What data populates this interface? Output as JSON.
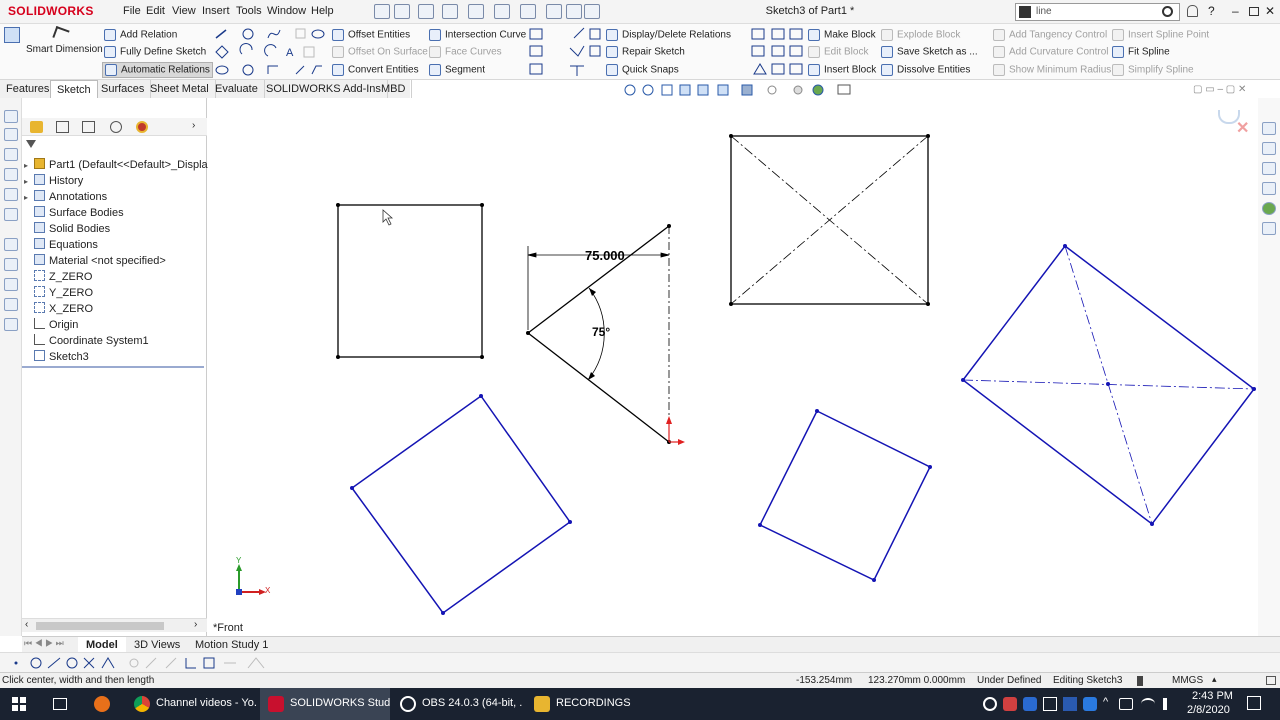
{
  "app": {
    "logo_text": "SOLIDWORKS",
    "doc_title": "Sketch3 of Part1 *",
    "search_value": "line",
    "accent": "#d6001c"
  },
  "menu": [
    "File",
    "Edit",
    "View",
    "Insert",
    "Tools",
    "Window",
    "Help"
  ],
  "ribbon": {
    "smart_dimension": "Smart Dimension",
    "col1": [
      "Add Relation",
      "Fully Define Sketch",
      "Automatic Relations"
    ],
    "col2": [
      "Offset Entities",
      "Offset On Surface",
      "Convert Entities"
    ],
    "col3": [
      "Intersection Curve",
      "Face Curves",
      "Segment"
    ],
    "col4": [
      "Display/Delete Relations",
      "Repair Sketch",
      "Quick Snaps"
    ],
    "col5": [
      "Make Block",
      "Edit Block",
      "Insert Block"
    ],
    "col6": [
      "Explode Block",
      "Save Sketch as ...",
      "Dissolve Entities"
    ],
    "col7": [
      "Add Tangency Control",
      "Add Curvature Control",
      "Show Minimum Radius"
    ],
    "col8": [
      "Insert Spline Point",
      "Fit Spline",
      "Simplify Spline"
    ]
  },
  "tabs": [
    "Features",
    "Sketch",
    "Surfaces",
    "Sheet Metal",
    "Evaluate",
    "SOLIDWORKS Add-Ins",
    "MBD"
  ],
  "tree": {
    "root": "Part1  (Default<<Default>_Displa",
    "items": [
      "History",
      "Annotations",
      "Surface Bodies",
      "Solid Bodies",
      "Equations",
      "Material <not specified>",
      "Z_ZERO",
      "Y_ZERO",
      "X_ZERO",
      "Origin",
      "Coordinate System1",
      "Sketch3"
    ]
  },
  "canvas": {
    "view_label": "*Front",
    "dim_length": "75.000",
    "dim_angle": "75°",
    "axis_y": "Y",
    "axis_x": "X",
    "sketch_color": "#1414b4",
    "line_color": "#000000"
  },
  "bottom_tabs": [
    "Model",
    "3D Views",
    "Motion Study 1"
  ],
  "status": {
    "hint": "Click center, width and then length",
    "x": "-153.254mm",
    "y": "123.270mm 0.000mm",
    "state": "Under Defined",
    "mode": "Editing Sketch3",
    "units": "MMGS"
  },
  "taskbar": {
    "items": [
      "Channel videos - Yo...",
      "SOLIDWORKS Stud...",
      "OBS 24.0.3 (64-bit, ...",
      "RECORDINGS"
    ],
    "time": "2:43 PM",
    "date": "2/8/2020"
  }
}
